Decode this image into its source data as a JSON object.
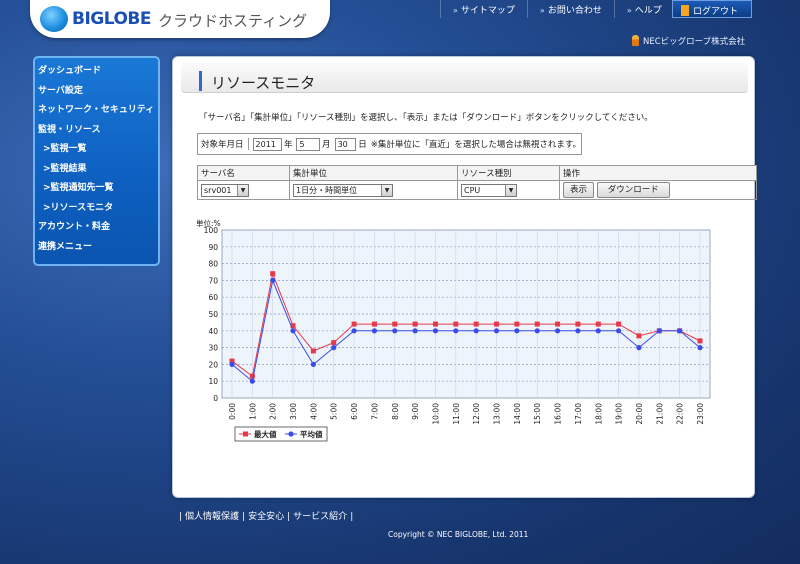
{
  "header": {
    "logo_text": "BIGLOBE",
    "logo_sub": "クラウドホスティング",
    "nav": [
      "サイトマップ",
      "お問い合わせ",
      "ヘルプ"
    ],
    "logout": "ログアウト",
    "company": "NECビッグローブ株式会社"
  },
  "sidebar": {
    "items": [
      {
        "label": "ダッシュボード"
      },
      {
        "label": "サーバ設定"
      },
      {
        "label": "ネットワーク・セキュリティ"
      },
      {
        "label": "監視・リソース"
      },
      {
        "label": ">監視一覧"
      },
      {
        "label": ">監視結果"
      },
      {
        "label": ">監視通知先一覧"
      },
      {
        "label": ">リソースモニタ"
      },
      {
        "label": "アカウント・料金"
      },
      {
        "label": "連携メニュー"
      }
    ]
  },
  "main": {
    "title": "リソースモニタ",
    "instruction": "「サーバ名」「集計単位」「リソース種別」を選択し、「表示」または「ダウンロード」ボタンをクリックしてください。",
    "date": {
      "label": "対象年月日",
      "year": "2011",
      "year_unit": "年",
      "month": "5",
      "month_unit": "月",
      "day": "30",
      "day_unit": "日",
      "note": "※集計単位に「直近」を選択した場合は無視されます。"
    },
    "table": {
      "headers": [
        "サーバ名",
        "集計単位",
        "リソース種別",
        "操作"
      ],
      "server": "srv001",
      "unit": "1日分・時間単位",
      "resource": "CPU",
      "show_button": "表示",
      "download_button": "ダウンロード"
    }
  },
  "chart_data": {
    "type": "line",
    "ylabel": "単位:%",
    "ylim": [
      0,
      100
    ],
    "yticks": [
      0,
      10,
      20,
      30,
      40,
      50,
      60,
      70,
      80,
      90,
      100
    ],
    "categories": [
      "0:00",
      "1:00",
      "2:00",
      "3:00",
      "4:00",
      "5:00",
      "6:00",
      "7:00",
      "8:00",
      "9:00",
      "10:00",
      "11:00",
      "12:00",
      "13:00",
      "14:00",
      "15:00",
      "16:00",
      "17:00",
      "18:00",
      "19:00",
      "20:00",
      "21:00",
      "22:00",
      "23:00"
    ],
    "series": [
      {
        "name": "最大値",
        "color": "#e8394a",
        "marker": "square",
        "values": [
          22,
          13,
          74,
          43,
          28,
          33,
          44,
          44,
          44,
          44,
          44,
          44,
          44,
          44,
          44,
          44,
          44,
          44,
          44,
          44,
          37,
          40,
          40,
          34
        ]
      },
      {
        "name": "平均値",
        "color": "#3b4ce8",
        "marker": "circle",
        "values": [
          20,
          10,
          70,
          40,
          20,
          30,
          40,
          40,
          40,
          40,
          40,
          40,
          40,
          40,
          40,
          40,
          40,
          40,
          40,
          40,
          30,
          40,
          40,
          30
        ]
      }
    ],
    "grid": true,
    "legend": "bottom-left"
  },
  "footer": {
    "links": [
      "個人情報保護",
      "安全安心",
      "サービス紹介"
    ],
    "copyright": "Copyright © NEC BIGLOBE, Ltd. 2011"
  }
}
